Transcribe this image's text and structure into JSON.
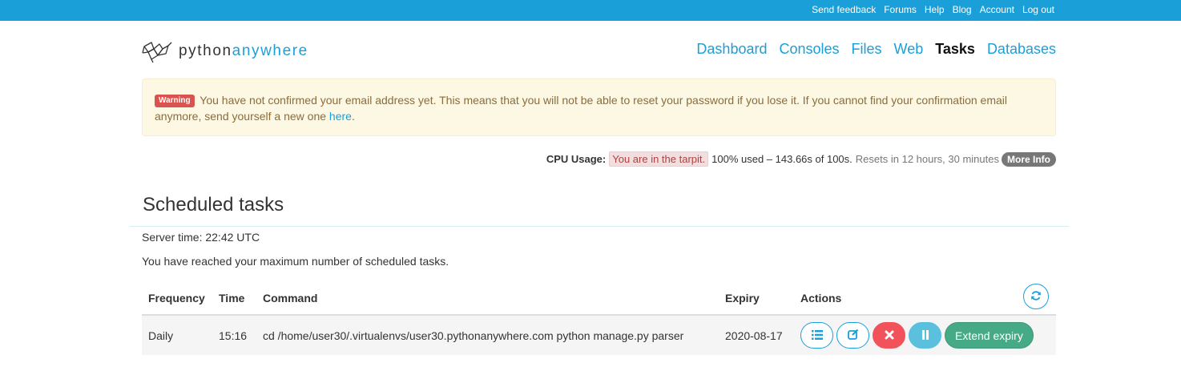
{
  "topbar": {
    "links": [
      "Send feedback",
      "Forums",
      "Help",
      "Blog",
      "Account",
      "Log out"
    ]
  },
  "logo": {
    "part1": "python",
    "part2": "anywhere"
  },
  "nav": {
    "items": [
      "Dashboard",
      "Consoles",
      "Files",
      "Web",
      "Tasks",
      "Databases"
    ],
    "active": "Tasks"
  },
  "alert": {
    "badge": "Warning",
    "text": "You have not confirmed your email address yet. This means that you will not be able to reset your password if you lose it. If you cannot find your confirmation email anymore, send yourself a new one",
    "link": "here",
    "suffix": "."
  },
  "cpu": {
    "label": "CPU Usage:",
    "status": "You are in the tarpit.",
    "usage": "100% used – 143.66s of 100s.",
    "resets": "Resets in 12 hours, 30 minutes",
    "more_info": "More Info"
  },
  "page": {
    "title": "Scheduled tasks",
    "server_time": "Server time: 22:42 UTC",
    "max_message": "You have reached your maximum number of scheduled tasks."
  },
  "table": {
    "headers": [
      "Frequency",
      "Time",
      "Command",
      "Expiry",
      "Actions"
    ],
    "rows": [
      {
        "frequency": "Daily",
        "time": "15:16",
        "command": "cd /home/user30/.virtualenvs/user30.pythonanywhere.com python manage.py parser",
        "expiry": "2020-08-17",
        "extend_label": "Extend expiry"
      }
    ]
  },
  "icons": {
    "refresh": "refresh-icon",
    "log": "list-icon",
    "edit": "edit-icon",
    "delete": "close-icon",
    "pause": "pause-icon"
  },
  "colors": {
    "brand": "#1a9fd8",
    "warning_badge": "#d9534f",
    "delete_button": "#f2535b",
    "pause_button": "#5bc0de",
    "extend_button": "#45aa85"
  }
}
